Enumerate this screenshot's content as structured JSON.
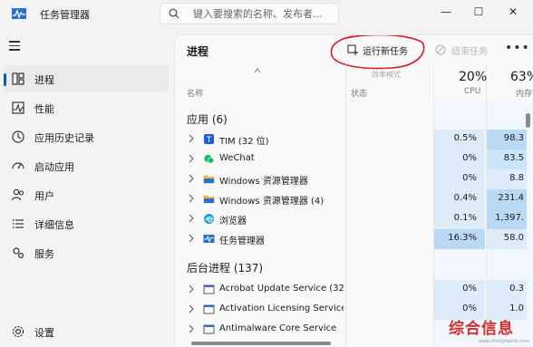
{
  "app": {
    "title": "任务管理器"
  },
  "search": {
    "placeholder": "键入要搜索的名称、发布者..."
  },
  "window_controls": {
    "minimize": "—",
    "maximize": "☐",
    "close": "✕"
  },
  "sidebar": {
    "items": [
      {
        "label": "进程",
        "icon": "processes-icon",
        "active": true
      },
      {
        "label": "性能",
        "icon": "performance-icon",
        "active": false
      },
      {
        "label": "应用历史记录",
        "icon": "app-history-icon",
        "active": false
      },
      {
        "label": "启动应用",
        "icon": "startup-apps-icon",
        "active": false
      },
      {
        "label": "用户",
        "icon": "users-icon",
        "active": false
      },
      {
        "label": "详细信息",
        "icon": "details-icon",
        "active": false
      },
      {
        "label": "服务",
        "icon": "services-icon",
        "active": false
      }
    ],
    "settings_label": "设置"
  },
  "toolbar": {
    "page_title": "进程",
    "run_new_task": "运行新任务",
    "end_task": "结束任务",
    "more": "•••"
  },
  "columns": {
    "name": "名称",
    "status_top": "效率模式",
    "status": "状态",
    "cpu_pct": "20%",
    "cpu": "CPU",
    "mem_pct": "63%",
    "mem": "内存"
  },
  "apps_group": {
    "title": "应用 (6)"
  },
  "background_group": {
    "title": "后台进程 (137)"
  },
  "apps": [
    {
      "name": "TIM (32 位)",
      "icon": "tim-icon",
      "cpu": "0.5%",
      "mem": "98.3"
    },
    {
      "name": "WeChat",
      "icon": "wechat-icon",
      "cpu": "0%",
      "mem": "83.5"
    },
    {
      "name": "Windows 资源管理器",
      "icon": "folder-icon",
      "cpu": "0%",
      "mem": "8.8"
    },
    {
      "name": "Windows 资源管理器 (4)",
      "icon": "folder-icon",
      "cpu": "0.4%",
      "mem": "231.4"
    },
    {
      "name": "浏览器",
      "icon": "edge-icon",
      "cpu": "0.1%",
      "mem": "1,397."
    },
    {
      "name": "任务管理器",
      "icon": "task-manager-icon",
      "cpu": "16.3%",
      "mem": "58.0"
    }
  ],
  "background": [
    {
      "name": "Acrobat Update Service (32 ...",
      "icon": "service-window-icon",
      "cpu": "0%",
      "mem": "0.3"
    },
    {
      "name": "Activation Licensing Service...",
      "icon": "service-window-icon",
      "cpu": "0%",
      "mem": "1.0"
    },
    {
      "name": "Antimalware Core Service",
      "icon": "service-window-icon",
      "cpu": "",
      "mem": ""
    }
  ],
  "watermark": {
    "text": "综合信息",
    "sub": "www.zhongheinfo.com"
  },
  "colors": {
    "accent": "#005fb8",
    "heat_light": "#deecf9",
    "heat_mid": "#cce4f7",
    "heat_strong": "#b9d9f4",
    "annotation": "#d32f2f"
  }
}
